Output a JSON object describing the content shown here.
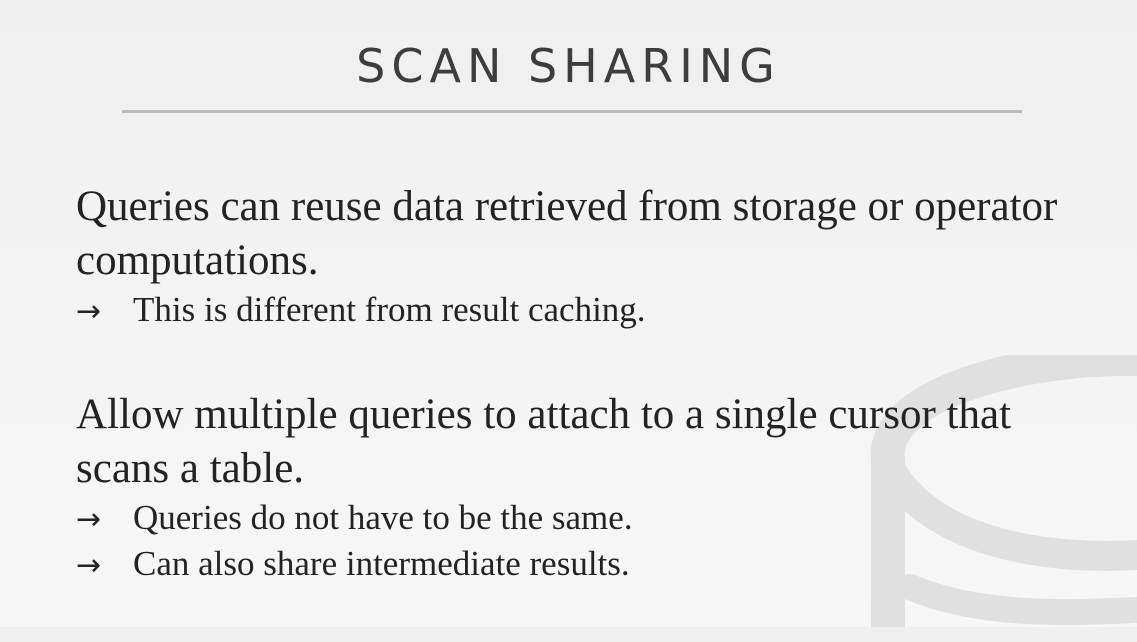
{
  "slide": {
    "title": "SCAN SHARING",
    "bullets": [
      {
        "text": "Queries can reuse data retrieved from storage or operator computations.",
        "subs": [
          "This is different from result caching."
        ]
      },
      {
        "text": "Allow multiple queries to attach to a single cursor that scans a table.",
        "subs": [
          "Queries do not have to be the same.",
          "Can also share intermediate results."
        ]
      }
    ],
    "arrow_glyph": "→",
    "watermark_icon": "database-cylinder-icon"
  }
}
